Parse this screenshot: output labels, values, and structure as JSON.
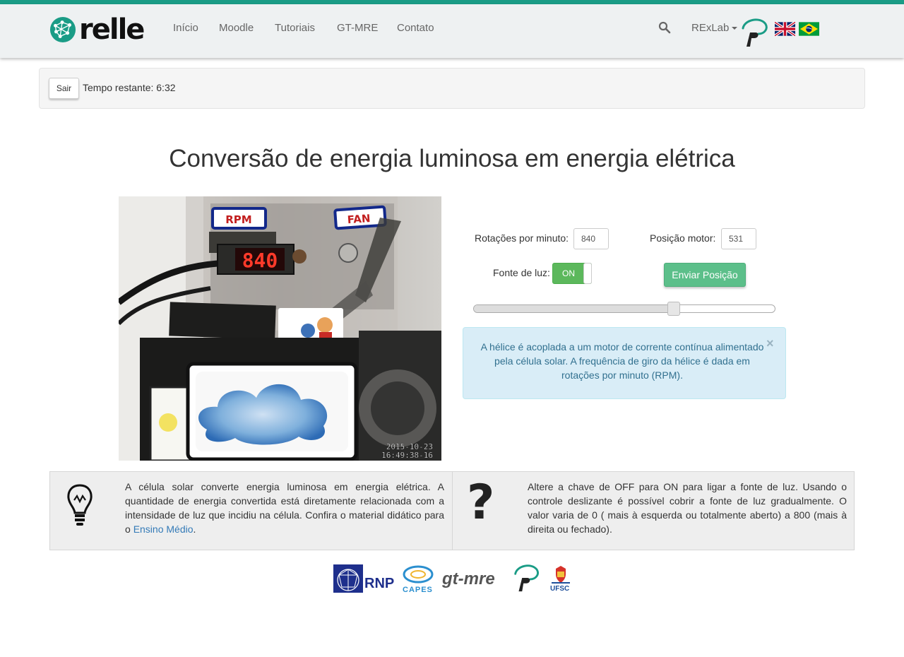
{
  "brand": {
    "name": "relle"
  },
  "nav": {
    "items": [
      "Início",
      "Moodle",
      "Tutoriais",
      "GT-MRE",
      "Contato"
    ],
    "lab_menu": "RExLab",
    "icons": [
      "search-icon",
      "rexlab-logo",
      "flag-uk-icon",
      "flag-br-icon"
    ]
  },
  "session": {
    "exit_label": "Sair",
    "time_label": "Tempo restante: 6:32"
  },
  "page": {
    "title": "Conversão de energia luminosa em energia elétrica"
  },
  "camera": {
    "rpm_tag": "RPM",
    "fan_tag": "FAN",
    "display_value": "840",
    "date": "2015-10-23",
    "time": "16:49:38-16"
  },
  "controls": {
    "rpm_label": "Rotações por minuto:",
    "rpm_value": "840",
    "motor_label": "Posição motor:",
    "motor_value": "531",
    "light_label": "Fonte de luz:",
    "light_state": "ON",
    "send_label": "Enviar Posição",
    "slider": {
      "min": 0,
      "max": 800,
      "value": 531
    }
  },
  "alert": {
    "text": "A hélice é acoplada a um motor de corrente contínua alimentado pela célula solar. A frequência de giro da hélice é dada em rotações por minuto (RPM).",
    "close": "×"
  },
  "panels": {
    "left_text": "A célula solar converte energia luminosa em energia elétrica. A quantidade de energia convertida está diretamente relacionada com a intensidade de luz que incidiu na célula. Confira o material didático para o ",
    "left_link": "Ensino Médio",
    "left_end": ".",
    "right_icon": "?",
    "right_text": "Altere a chave de OFF para ON para ligar a fonte de luz. Usando o controle deslizante é possível cobrir a fonte de luz gradualmente. O valor varia de 0 ( mais à esquerda ou totalmente aberto) a 800 (mais à direita ou fechado)."
  },
  "partners": [
    "RNP",
    "CAPES",
    "gt-mre",
    "UFSC"
  ],
  "colors": {
    "accent": "#1a9c86",
    "send_button": "#5cbf8a",
    "toggle_on": "#5cb85c",
    "alert_bg": "#d9edf7",
    "alert_text": "#31708f",
    "link": "#337ab7"
  }
}
